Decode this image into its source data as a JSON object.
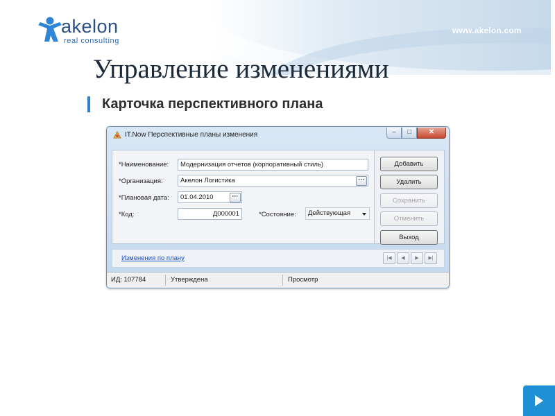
{
  "branding": {
    "logo_word": "akelon",
    "logo_sub": "real  consulting",
    "site_url": "www.akelon.com",
    "brand_color": "#2a4f86",
    "accent_color": "#2f7fd0"
  },
  "slide": {
    "title": "Управление изменениями",
    "subtitle": "Карточка перспективного плана"
  },
  "window": {
    "title": "IT.Now Перспективные планы изменения",
    "controls": {
      "minimize": "–",
      "maximize": "□",
      "close": "✕"
    }
  },
  "form": {
    "name": {
      "label": "*Наименование:",
      "value": "Модернизация отчетов (корпоративный стиль)"
    },
    "organization": {
      "label": "*Организация:",
      "value": "Акелон Логистика",
      "picker": "···"
    },
    "plan_date": {
      "label": "*Плановая дата:",
      "value": "01.04.2010",
      "picker": "···"
    },
    "code": {
      "label": "*Код:",
      "value": "Д000001"
    },
    "state": {
      "label": "*Состояние:",
      "value": "Действующая"
    }
  },
  "actions": {
    "add": "Добавить",
    "delete": "Удалить",
    "save": "Сохранить",
    "cancel": "Отменить",
    "exit": "Выход"
  },
  "footer_link": "Изменения по плану",
  "navigator": {
    "first": "|◀",
    "prev": "◀",
    "next": "▶",
    "last": "▶|"
  },
  "status": {
    "id": "ИД: 107784",
    "state": "Утверждена",
    "mode": "Просмотр"
  },
  "icons": {
    "logo": "akelon-figure-icon",
    "app": "app-icon",
    "next_slide": "next-slide-arrow-icon"
  }
}
